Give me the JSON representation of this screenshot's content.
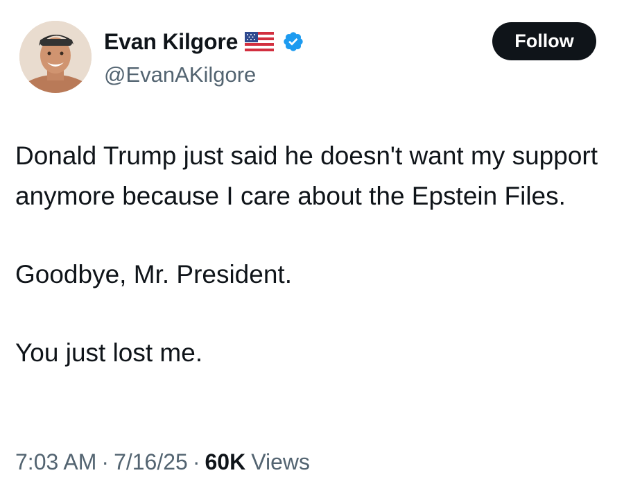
{
  "author": {
    "display_name": "Evan Kilgore",
    "handle": "@EvanAKilgore",
    "flag_icon": "us-flag-icon",
    "verified_icon": "verified-badge-icon",
    "verified_color": "#1d9bf0"
  },
  "follow_button": {
    "label": "Follow"
  },
  "tweet": {
    "lines": [
      "Donald Trump just said he doesn't want my support anymore because I care about the Epstein Files.",
      "Goodbye, Mr. President.",
      "You just lost me."
    ]
  },
  "meta": {
    "time": "7:03 AM",
    "separator": "·",
    "date": "7/16/25",
    "view_count": "60K",
    "views_label": "Views"
  },
  "colors": {
    "text": "#0f1419",
    "secondary": "#536471",
    "button_bg": "#0f1419"
  }
}
